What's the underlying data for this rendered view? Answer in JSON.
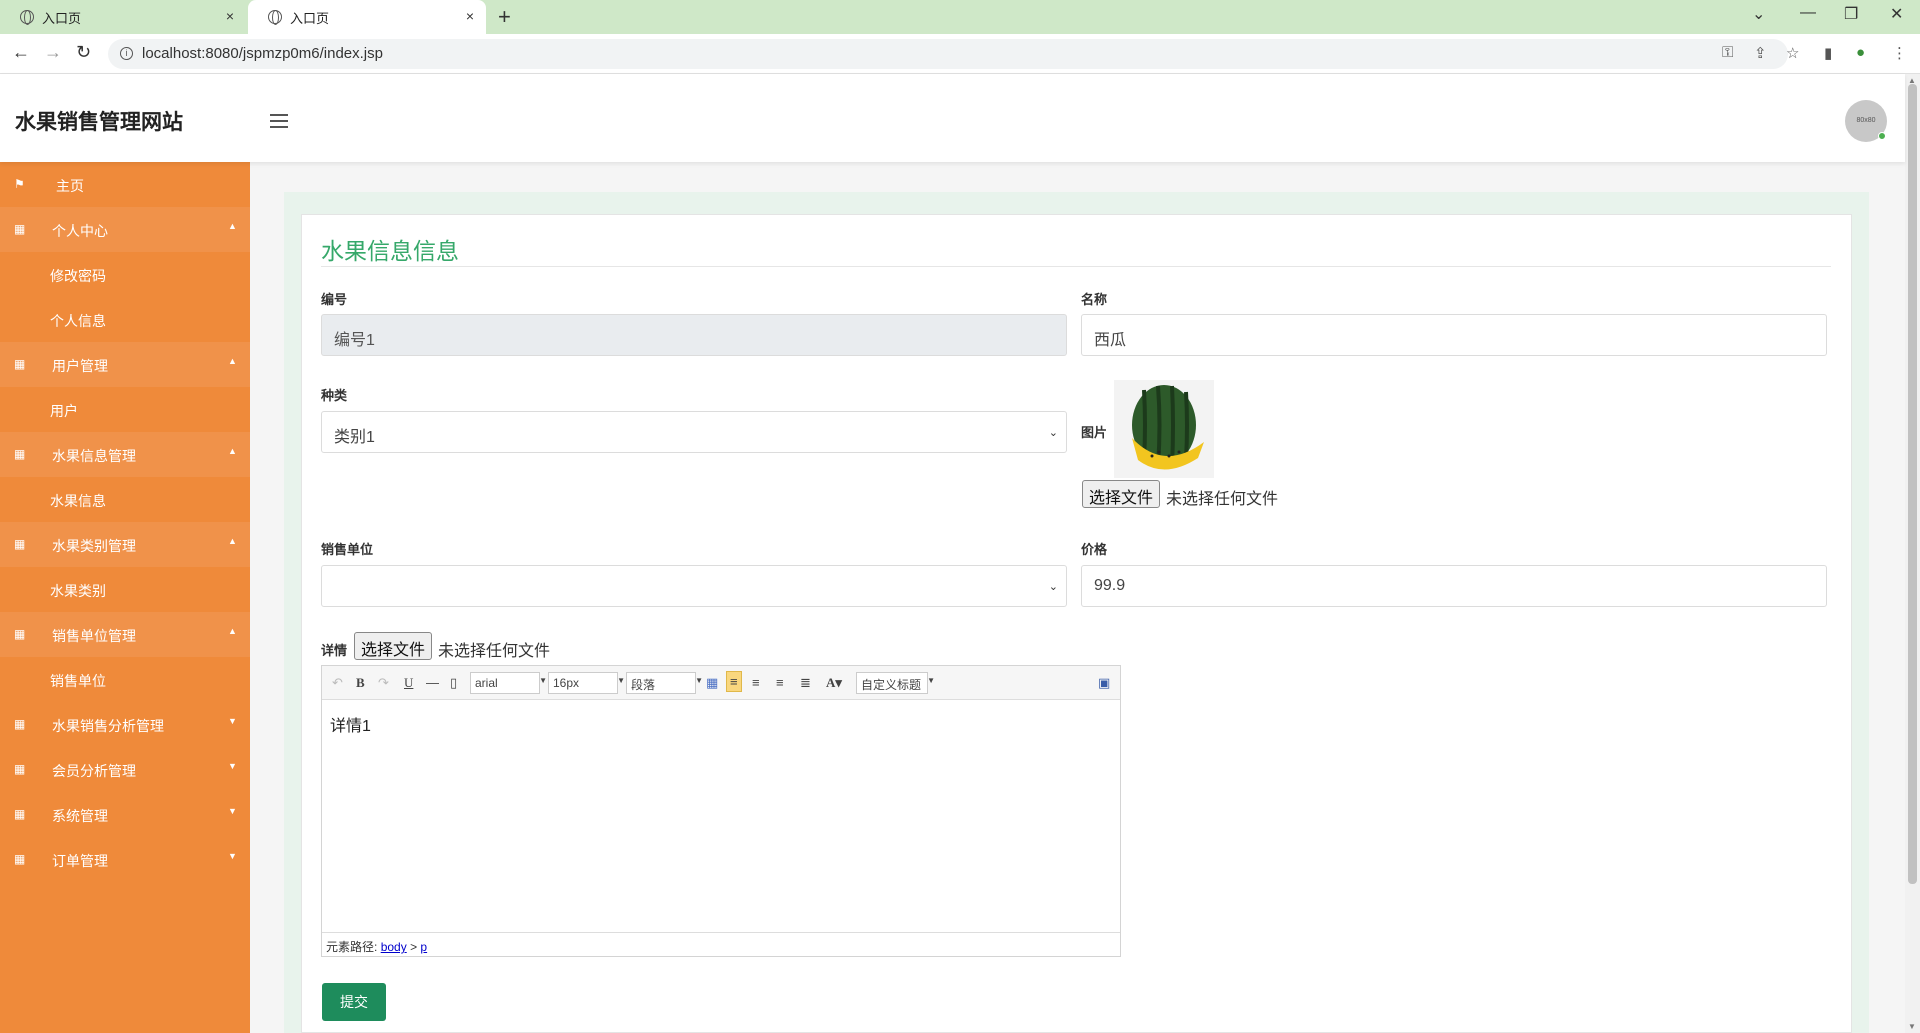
{
  "browser": {
    "tabs": [
      {
        "title": "入口页",
        "close": "×"
      },
      {
        "title": "入口页",
        "close": "×"
      }
    ],
    "new_tab": "+",
    "url": "localhost:8080/jspmzp0m6/index.jsp"
  },
  "header": {
    "brand": "水果销售管理网站",
    "avatar_text": "80x80"
  },
  "sidebar": {
    "items": [
      {
        "label": "主页",
        "type": "top"
      },
      {
        "label": "个人中心",
        "type": "group"
      },
      {
        "label": "修改密码",
        "type": "sub"
      },
      {
        "label": "个人信息",
        "type": "sub"
      },
      {
        "label": "用户管理",
        "type": "group"
      },
      {
        "label": "用户",
        "type": "sub"
      },
      {
        "label": "水果信息管理",
        "type": "group"
      },
      {
        "label": "水果信息",
        "type": "sub"
      },
      {
        "label": "水果类别管理",
        "type": "group"
      },
      {
        "label": "水果类别",
        "type": "sub"
      },
      {
        "label": "销售单位管理",
        "type": "group"
      },
      {
        "label": "销售单位",
        "type": "sub"
      },
      {
        "label": "水果销售分析管理",
        "type": "group"
      },
      {
        "label": "会员分析管理",
        "type": "group"
      },
      {
        "label": "系统管理",
        "type": "group"
      },
      {
        "label": "订单管理",
        "type": "group"
      }
    ]
  },
  "form": {
    "title": "水果信息信息",
    "number_label": "编号",
    "number_value": "编号1",
    "name_label": "名称",
    "name_value": "西瓜",
    "category_label": "种类",
    "category_value": "类别1",
    "image_label": "图片",
    "file_button": "选择文件",
    "no_file_text": "未选择任何文件",
    "unit_label": "销售单位",
    "unit_value": "",
    "price_label": "价格",
    "price_value": "99.9",
    "detail_label": "详情",
    "submit_label": "提交"
  },
  "editor": {
    "font_family": "arial",
    "font_size": "16px",
    "paragraph": "段落",
    "custom_title": "自定义标题",
    "content": "详情1",
    "path_label": "元素路径:",
    "path_body": "body",
    "path_sep": ">",
    "path_p": "p"
  }
}
